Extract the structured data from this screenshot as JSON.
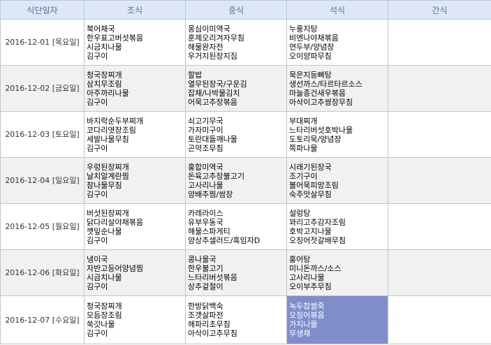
{
  "headers": [
    "식단일자",
    "조식",
    "중식",
    "석식",
    "간식"
  ],
  "rows": [
    {
      "date": "2016-12-01 [목요일]",
      "breakfast": [
        "북어채국",
        "한우표고버섯볶음",
        "시금치나물",
        "김구이"
      ],
      "lunch": [
        "옹심이미역국",
        "훈제오리겨자무침",
        "해물완자전",
        "우거지된장지짐"
      ],
      "dinner": [
        "누룽지탕",
        "비엔나야채볶음",
        "연두부/양념장",
        "오이양파무침"
      ],
      "snack": []
    },
    {
      "date": "2016-12-02 [금요일]",
      "breakfast": [
        "청국장찌개",
        "삼치무조림",
        "아주까리나물",
        "김구이"
      ],
      "lunch": [
        "할밥",
        "열무된장국/구운김",
        "잡채/나박물김치",
        "어묵고추장볶음"
      ],
      "dinner": [
        "묵은지등뼈탕",
        "생선까스/타르타르소스",
        "마늘종건새우볶음",
        "아삭이고추쌈장무침"
      ],
      "snack": []
    },
    {
      "date": "2016-12-03 [토요일]",
      "breakfast": [
        "바지락순두부찌개",
        "코다리엿장조림",
        "세발나물무침",
        "김구이"
      ],
      "lunch": [
        "쇠고기무국",
        "가자미구이",
        "토란대들깨나물",
        "곤약조무침"
      ],
      "dinner": [
        "부대찌개",
        "느타리버섯호박나물",
        "도토리묵/양념장",
        "쪽파나물"
      ],
      "snack": []
    },
    {
      "date": "2016-12-04 [일요일]",
      "breakfast": [
        "우렁된장찌개",
        "날치알계란찜",
        "참나물무침",
        "김구이"
      ],
      "lunch": [
        "홍합미역국",
        "돈육고추장불고기",
        "고사리나물",
        "양배추찜/쌈장"
      ],
      "dinner": [
        "시래기된장국",
        "조기구이",
        "불어묵피망조림",
        "숙주맛살무침"
      ],
      "snack": []
    },
    {
      "date": "2016-12-05 [월요일]",
      "breakfast": [
        "버섯된장찌개",
        "닭다리살야채볶음",
        "깻잎순나물",
        "김구이"
      ],
      "lunch": [
        "카레라이스",
        "유부우동국",
        "해물스파게티",
        "양상추샐러드/흑임자D"
      ],
      "dinner": [
        "설렁탕",
        "꽈리고추감자조림",
        "호박고지나물",
        "오징어젓갈배무침"
      ],
      "snack": []
    },
    {
      "date": "2016-12-06 [화요일]",
      "breakfast": [
        "냉이국",
        "자반고등어양념찜",
        "시금치나물",
        "김구이"
      ],
      "lunch": [
        "콩나물국",
        "한우불고기",
        "느타리버섯볶음",
        "상추겉절이"
      ],
      "dinner": [
        "홍어탕",
        "미니돈까스/소스",
        "고사리나물",
        "오이부추무침"
      ],
      "snack": []
    },
    {
      "date": "2016-12-07 [수요일]",
      "breakfast": [
        "청국장찌개",
        "모듬장조림",
        "쑥갓나물",
        "김구이"
      ],
      "lunch": [
        "한방닭백숙",
        "조갯살파전",
        "해파리초무침",
        "아삭이고추무침"
      ],
      "dinner": [
        "녹두찹쌀죽",
        "오징어볶음",
        "가지나물",
        "무생채"
      ],
      "snack": []
    }
  ],
  "selected_color": "#7f8ecb"
}
